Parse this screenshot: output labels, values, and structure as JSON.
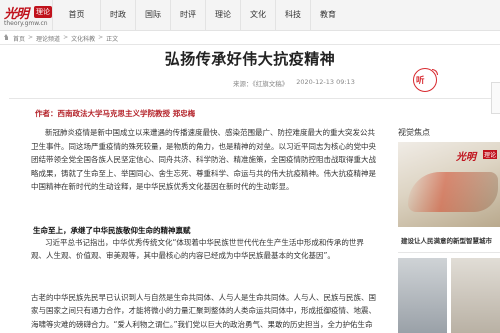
{
  "brand": {
    "logo_text": "光明",
    "tag": "理论",
    "url": "theory.gmw.cn"
  },
  "nav": [
    "首页",
    "时政",
    "国际",
    "时评",
    "理论",
    "文化",
    "科技",
    "教育"
  ],
  "breadcrumb": [
    "首页",
    "理论频道",
    "文化科教",
    "正文"
  ],
  "article": {
    "title": "弘扬传承好伟大抗疫精神",
    "source": "来源：《红旗文稿》",
    "date": "2020-12-13 09:13",
    "listen_label": "听",
    "author_line": "作者：西南政法大学马克思主义学院教授   郑忠梅",
    "paragraph1": "新冠肺炎疫情是新中国成立以来遭遇的传播速度最快、感染范围最广、防控难度最大的重大突发公共卫生事件。同这场严重疫情的殊死较量，是物质的角力，也是精神的对垒。以习近平同志为核心的党中央团结带领全党全国各族人民坚定信心、同舟共济、科学防治、精准施策，全国疫情防控阻击战取得重大战略成果，铸就了生命至上、举国同心、舍生忘死、尊重科学、命运与共的伟大抗疫精神。伟大抗疫精神是中国精神在新时代的生动诠释，是中华民族优秀文化基因在新时代的生动彰显。",
    "subheading1": "生命至上，承继了中华民族敬仰生命的精神禀赋",
    "paragraph2": "习近平总书记指出，中华优秀传统文化“体现着中华民族世世代代在生产生活中形成和传承的世界观、人生观、价值观、审美观等，其中最核心的内容已经成为中华民族最基本的文化基因”。",
    "paragraph3": "古老的中华民族先民早已认识到人与自然是生命共同体、人与人是生命共同体。人与人、民族与民族、国家与国家之间只有通力合作，才能将微小的力量汇聚到整体的人类命运共同体中，形成抵御疫情、地震、海啸等灾难的磅礴合力。“爱人利物之谓仁。”我们党以巨大的政治勇气、果敢的历史担当，全力护佑生命安全，悉心呵护生命尊严，抗疫斗争伟大实践集中体现了中华民族敬仰生命的精神禀赋。"
  },
  "sidebar": {
    "section_title": "视觉焦点",
    "card_logo": "光明",
    "card_tag": "理论",
    "caption": "建设让人民满意的新型智慧城市"
  }
}
